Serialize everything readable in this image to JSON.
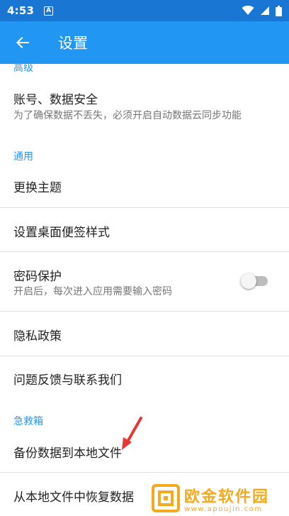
{
  "status_bar": {
    "time": "4:53",
    "notification_glyph": "A",
    "icons": [
      "wifi-icon",
      "signal-icon",
      "battery-icon"
    ]
  },
  "app_bar": {
    "back_icon": "arrow-back-icon",
    "title": "设置",
    "color": "#2196f3"
  },
  "sections": {
    "advanced": {
      "header": "高级"
    },
    "general": {
      "header": "通用"
    },
    "emergency": {
      "header": "急救箱"
    }
  },
  "items": {
    "account": {
      "title": "账号、数据安全",
      "subtitle": "为了确保数据不丢失，必须开启自动数据云同步功能"
    },
    "theme": {
      "title": "更换主题"
    },
    "desktop_note": {
      "title": "设置桌面便签样式"
    },
    "password": {
      "title": "密码保护",
      "subtitle": "开启后，每次进入应用需要输入密码",
      "toggle_on": false
    },
    "privacy": {
      "title": "隐私政策"
    },
    "feedback": {
      "title": "问题反馈与联系我们"
    },
    "backup": {
      "title": "备份数据到本地文件"
    },
    "restore": {
      "title": "从本地文件中恢复数据"
    }
  },
  "watermark": {
    "name": "欧金软件园",
    "url": "www.apoujin.com"
  },
  "colors": {
    "accent": "#2196f3",
    "status_bar": "#1976d2",
    "annotation_arrow": "#e53935"
  }
}
